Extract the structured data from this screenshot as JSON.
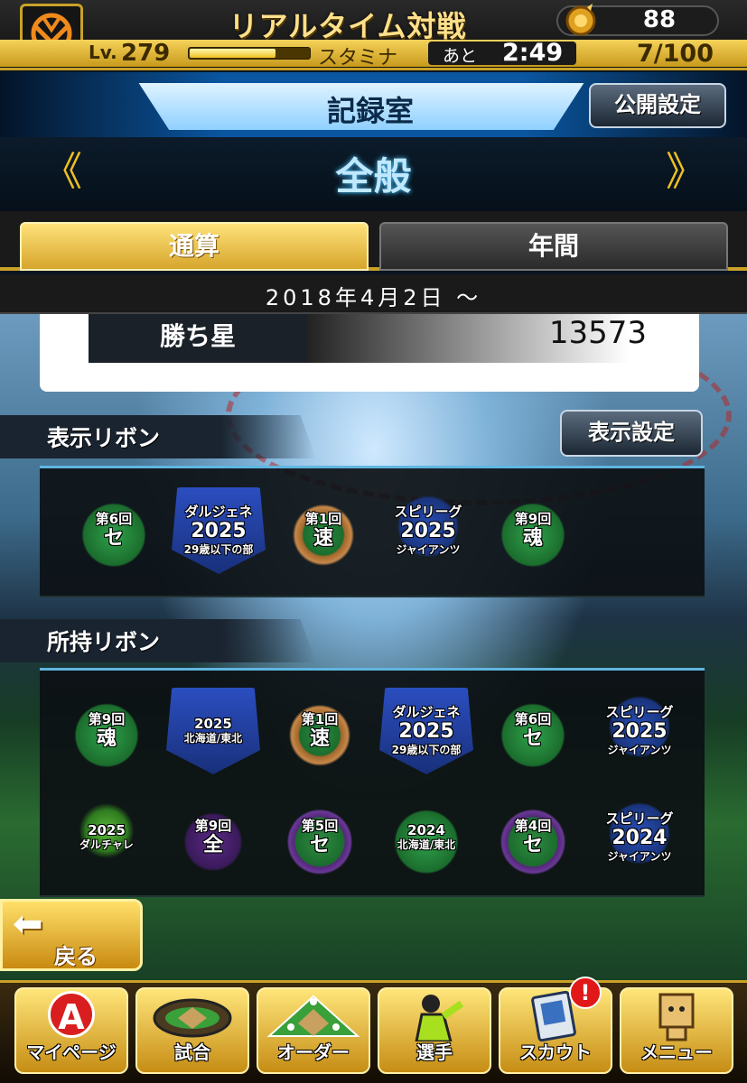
{
  "header": {
    "mode_title": "リアルタイム対戦",
    "coins": "88",
    "level_label": "Lv.",
    "level": "279",
    "stamina_label": "スタミナ",
    "recovery_label": "あと",
    "recovery_time": "2:49",
    "stamina_count": "7/100",
    "stamina_fraction": 0.07
  },
  "record_room": {
    "title": "記録室",
    "public_settings_button": "公開設定",
    "category": "全般",
    "prev_glyph": "《",
    "next_glyph": "》"
  },
  "tabs": [
    {
      "label": "通算",
      "active": true
    },
    {
      "label": "年間",
      "active": false
    }
  ],
  "date_range": "2018年4月2日 ～",
  "stats": {
    "wins_label": "勝ち星",
    "wins_value": "13573"
  },
  "display_ribbons": {
    "title": "表示リボン",
    "settings_button": "表示設定",
    "items": [
      {
        "l1": "第6回",
        "l2": "セ",
        "l3": ""
      },
      {
        "l1": "ダルジェネ",
        "l2": "2025",
        "l3": "29歳以下の部"
      },
      {
        "l1": "第1回",
        "l2": "速",
        "l3": ""
      },
      {
        "l1": "スピリーグ",
        "l2": "2025",
        "l3": "ジャイアンツ"
      },
      {
        "l1": "第9回",
        "l2": "魂",
        "l3": ""
      }
    ]
  },
  "owned_ribbons": {
    "title": "所持リボン",
    "items": [
      {
        "l1": "第9回",
        "l2": "魂",
        "l3": ""
      },
      {
        "l1": "2025",
        "l2": "",
        "l3": "北海道/東北"
      },
      {
        "l1": "第1回",
        "l2": "速",
        "l3": ""
      },
      {
        "l1": "ダルジェネ",
        "l2": "2025",
        "l3": "29歳以下の部"
      },
      {
        "l1": "第6回",
        "l2": "セ",
        "l3": ""
      },
      {
        "l1": "スピリーグ",
        "l2": "2025",
        "l3": "ジャイアンツ"
      },
      {
        "l1": "2025",
        "l2": "",
        "l3": "ダルチャレ"
      },
      {
        "l1": "第9回",
        "l2": "全",
        "l3": ""
      },
      {
        "l1": "第5回",
        "l2": "セ",
        "l3": ""
      },
      {
        "l1": "2024",
        "l2": "",
        "l3": "北海道/東北"
      },
      {
        "l1": "第4回",
        "l2": "セ",
        "l3": ""
      },
      {
        "l1": "スピリーグ",
        "l2": "2024",
        "l3": "ジャイアンツ"
      }
    ]
  },
  "back_button": {
    "arrow": "⬅",
    "label": "戻る"
  },
  "bottom_nav": {
    "mypage": {
      "label": "マイページ",
      "icon": "A"
    },
    "game": {
      "label": "試合",
      "icon": "◈"
    },
    "order": {
      "label": "オーダー",
      "icon": "⚾"
    },
    "player": {
      "label": "選手",
      "icon": "🧢"
    },
    "scout": {
      "label": "スカウト",
      "icon": "▤",
      "alert": "!"
    },
    "menu": {
      "label": "メニュー",
      "icon": "▣"
    }
  },
  "colors": {
    "accent_gold": "#c9a227",
    "panel_blue": "#5fb6e0",
    "alert_red": "#e01818"
  }
}
